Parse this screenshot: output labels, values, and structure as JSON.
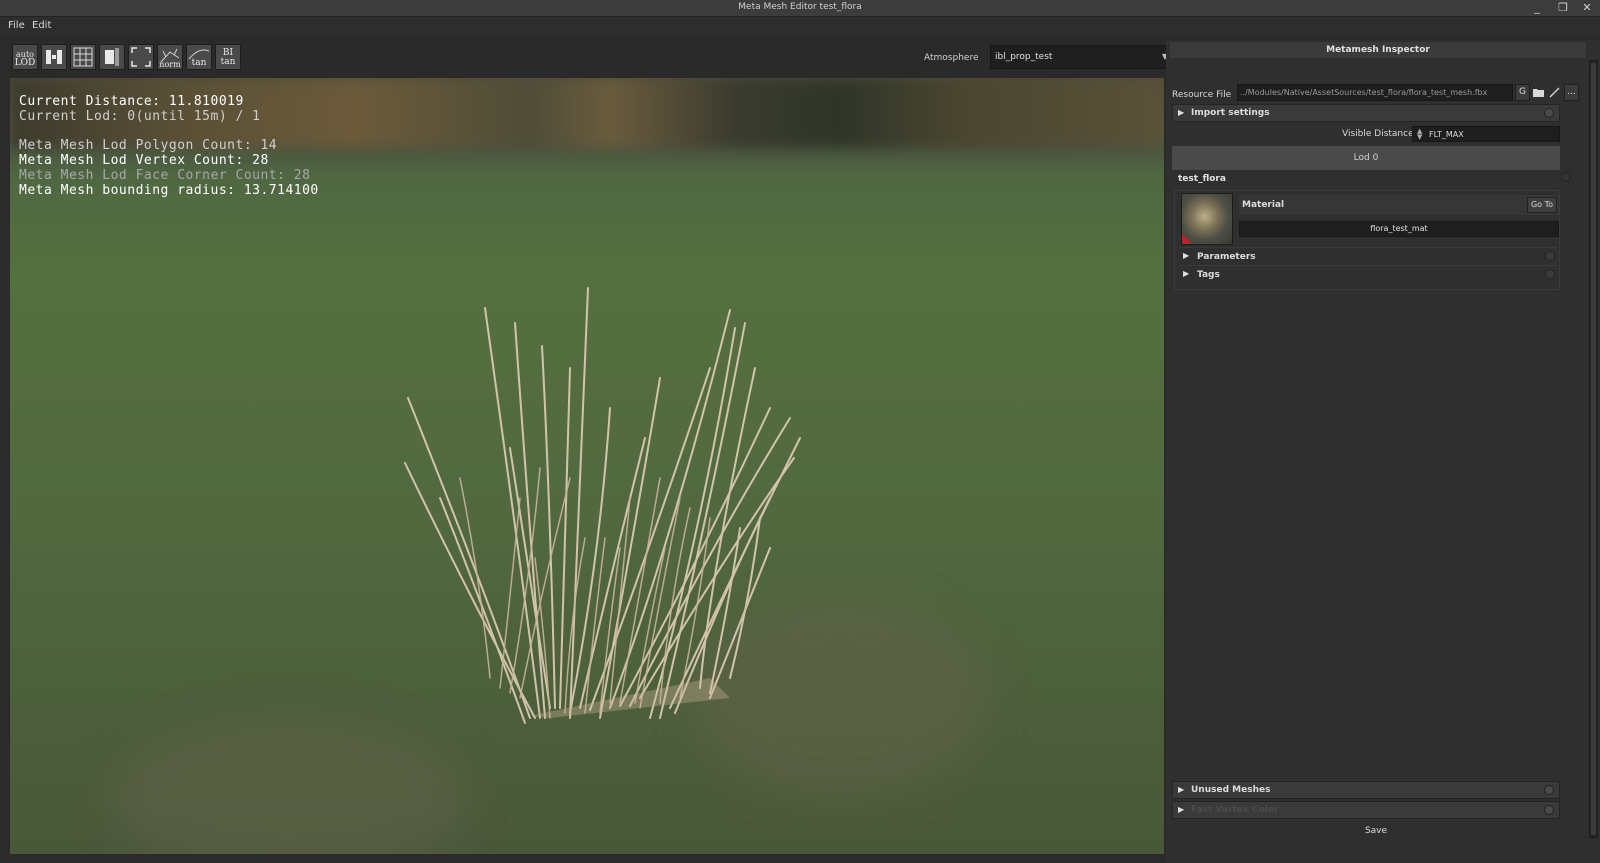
{
  "window": {
    "title": "Meta Mesh Editor test_flora",
    "minimize": "_",
    "maximize": "❐",
    "close": "✕"
  },
  "menu": [
    "File",
    "Edit"
  ],
  "toolbar": {
    "buttons": [
      {
        "label_top": "auto",
        "label_bottom": "LOD",
        "icon": "auto-lod-icon"
      },
      {
        "label_top": "",
        "label_bottom": "",
        "icon": "split-view-icon"
      },
      {
        "label_top": "",
        "label_bottom": "",
        "icon": "grid-icon"
      },
      {
        "label_top": "",
        "label_bottom": "",
        "icon": "half-shade-icon"
      },
      {
        "label_top": "",
        "label_bottom": "",
        "icon": "frame-bounds-icon"
      },
      {
        "label_top": "",
        "label_bottom": "norm",
        "icon": "normals-icon"
      },
      {
        "label_top": "",
        "label_bottom": "tan",
        "icon": "tangent-icon"
      },
      {
        "label_top": "BI",
        "label_bottom": "tan",
        "icon": "bitangent-icon"
      }
    ],
    "atmosphere_label": "Atmosphere",
    "atmosphere_value": "ibl_prop_test"
  },
  "viewport": {
    "current_distance": "Current Distance: 11.810019",
    "current_lod": "Current Lod: 0(until 15m) / 1",
    "polygon_count": "Meta Mesh Lod Polygon Count: 14",
    "vertex_count": "Meta Mesh Lod Vertex Count: 28",
    "face_corner_count": "Meta Mesh Lod Face Corner Count: 28",
    "bounding_radius": "Meta Mesh bounding radius: 13.714100"
  },
  "inspector": {
    "title": "Metamesh Inspector",
    "resource_file_label": "Resource File",
    "resource_file_path": "../Modules/Native/AssetSources/test_flora/flora_test_mesh.fbx",
    "g_button": "G",
    "folder_icon": "folder-icon",
    "edit_icon": "pencil-icon",
    "more_button": "...",
    "import_settings": "Import settings",
    "visible_distance_label": "Visible Distance",
    "visible_distance_value": "FLT_MAX",
    "lod_header": "Lod 0",
    "mesh_name": "test_flora",
    "material_label": "Material",
    "goto_button": "Go To",
    "material_name": "flora_test_mat",
    "parameters": "Parameters",
    "tags": "Tags",
    "unused_meshes": "Unused Meshes",
    "faint_section": "Fast Vertex Color",
    "save": "Save"
  }
}
